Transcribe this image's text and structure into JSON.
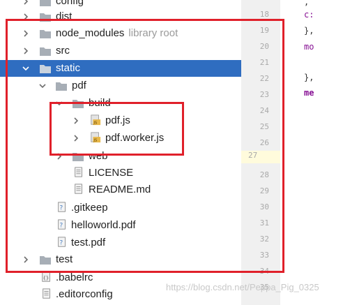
{
  "tree": {
    "items": [
      {
        "label": "config",
        "suffix": "",
        "icon": "folder",
        "expanded": false
      },
      {
        "label": "dist",
        "suffix": "",
        "icon": "folder",
        "expanded": false
      },
      {
        "label": "node_modules",
        "suffix": "library root",
        "icon": "folder",
        "expanded": false
      },
      {
        "label": "src",
        "suffix": "",
        "icon": "folder",
        "expanded": false
      },
      {
        "label": "static",
        "suffix": "",
        "icon": "folder",
        "expanded": true,
        "selected": true
      },
      {
        "label": "pdf",
        "suffix": "",
        "icon": "folder",
        "expanded": true
      },
      {
        "label": "build",
        "suffix": "",
        "icon": "folder",
        "expanded": true
      },
      {
        "label": "pdf.js",
        "suffix": "",
        "icon": "js-file",
        "expanded": false
      },
      {
        "label": "pdf.worker.js",
        "suffix": "",
        "icon": "js-file",
        "expanded": false
      },
      {
        "label": "web",
        "suffix": "",
        "icon": "folder",
        "expanded": false
      },
      {
        "label": "LICENSE",
        "suffix": "",
        "icon": "text-file"
      },
      {
        "label": "README.md",
        "suffix": "",
        "icon": "text-file"
      },
      {
        "label": ".gitkeep",
        "suffix": "",
        "icon": "text-file"
      },
      {
        "label": "helloworld.pdf",
        "suffix": "",
        "icon": "text-file"
      },
      {
        "label": "test.pdf",
        "suffix": "",
        "icon": "text-file"
      },
      {
        "label": "test",
        "suffix": "",
        "icon": "folder",
        "expanded": false
      },
      {
        "label": ".babelrc",
        "suffix": "",
        "icon": "config-file"
      },
      {
        "label": ".editorconfig",
        "suffix": "",
        "icon": "text-file"
      }
    ]
  },
  "gutter": {
    "lines": [
      "18",
      "19",
      "20",
      "21",
      "22",
      "23",
      "24",
      "25",
      "26",
      "27",
      "28",
      "29",
      "30",
      "31",
      "32",
      "33",
      "34",
      "35"
    ]
  },
  "editor": {
    "snippets": [
      ",",
      "c:",
      "},",
      "mo",
      "},",
      "me"
    ]
  },
  "watermark": "https://blog.csdn.net/Peppa_Pig_0325",
  "colors": {
    "selection": "#2f6dc0",
    "highlight_box": "#e0202a",
    "folder": "#a7aeb6"
  }
}
